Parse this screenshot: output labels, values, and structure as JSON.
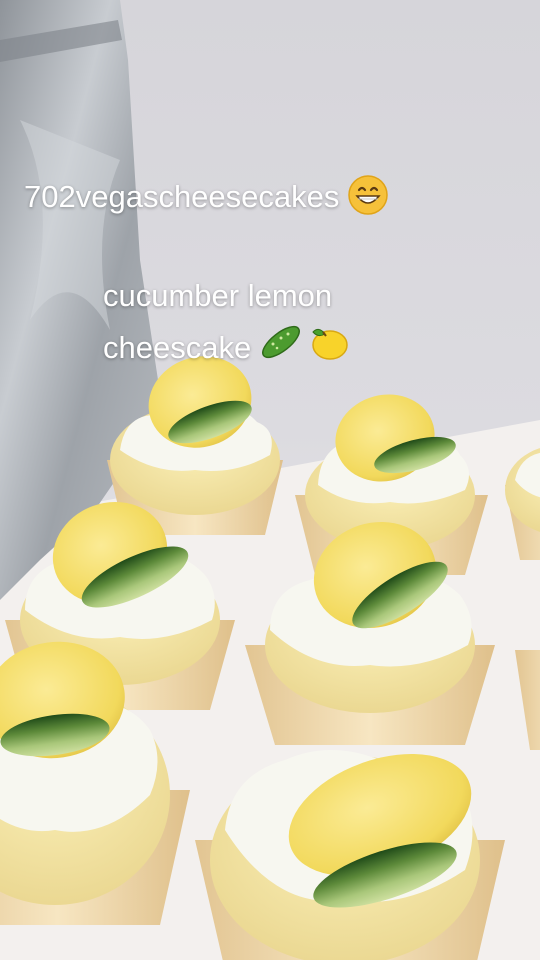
{
  "overlay": {
    "handle": "702vegascheesecakes",
    "handle_emoji": "grinning-face-emoji",
    "caption_line1": "cucumber lemon",
    "caption_line2": "cheescake",
    "caption_emojis": [
      "cucumber-emoji",
      "lemon-emoji"
    ]
  },
  "colors": {
    "backdrop": "#d9d8dc",
    "foil_bag": "#a4a8ad",
    "cheesecake": "#f1e3a6",
    "frosting": "#f6f6ef",
    "lemon": "#f3dc6a",
    "cucumber": "#2f5d22",
    "liner": "#efd6a8"
  }
}
